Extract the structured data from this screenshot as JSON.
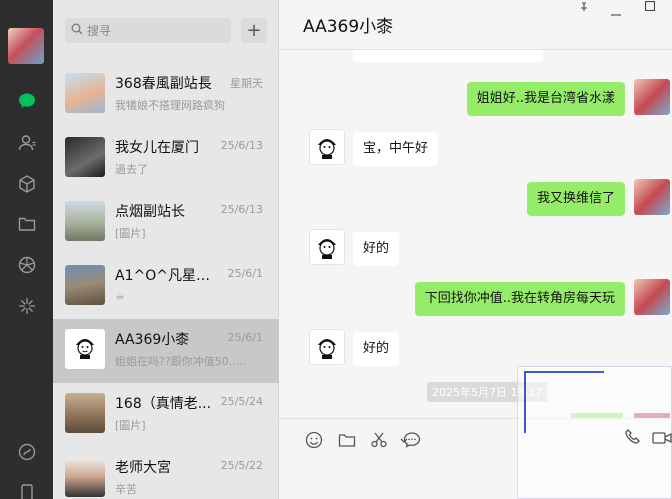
{
  "search": {
    "placeholder": "搜寻"
  },
  "add_button": {
    "label": "+"
  },
  "chats": [
    {
      "name": "368春風副站長",
      "date": "星期天",
      "preview": "我犠娘不搭理网路疯狗"
    },
    {
      "name": "我女儿在厦门",
      "date": "25/6/13",
      "preview": "過去了"
    },
    {
      "name": "点烟副站长",
      "date": "25/6/13",
      "preview": "[圖片]"
    },
    {
      "name": "A1^O^凡星（...",
      "date": "25/6/1",
      "preview": "☕"
    },
    {
      "name": "AA369小桼",
      "date": "25/6/1",
      "preview": "姐姐在吗??跟你冲值50....."
    },
    {
      "name": "168（真情老...",
      "date": "25/5/24",
      "preview": "[圖片]"
    },
    {
      "name": "老师大宮",
      "date": "25/5/22",
      "preview": "辛苦"
    }
  ],
  "conversation": {
    "title": "AA369小桼",
    "messages": [
      {
        "from": "me",
        "text": "姐姐好..我是台湾省水漾"
      },
      {
        "from": "them",
        "text": "宝，中午好"
      },
      {
        "from": "me",
        "text": "我又换维信了"
      },
      {
        "from": "them",
        "text": "好的"
      },
      {
        "from": "me",
        "text": "下回找你冲值..我在转角房每天玩"
      },
      {
        "from": "them",
        "text": "好的"
      }
    ],
    "timestamp": "2025年5月7日 13:17"
  },
  "colors": {
    "rail": "#2e2e2e",
    "list_bg": "#e7e7e7",
    "active_item": "#c8c8c8",
    "accent_green": "#07c160",
    "outgoing_bubble": "#95ec69",
    "selection_line": "#3c5ad2"
  },
  "icons": {
    "rail": [
      "chat-icon",
      "contacts-icon",
      "favorites-icon",
      "files-icon",
      "moments-icon",
      "mini-program-icon",
      "mini-program-link-icon",
      "phone-icon"
    ],
    "toolbar": [
      "emoji-icon",
      "folder-icon",
      "scissors-icon",
      "chat-bubble-icon",
      "phone-call-icon",
      "video-call-icon"
    ],
    "window": [
      "pin-icon",
      "minimize-icon",
      "maximize-icon"
    ]
  }
}
